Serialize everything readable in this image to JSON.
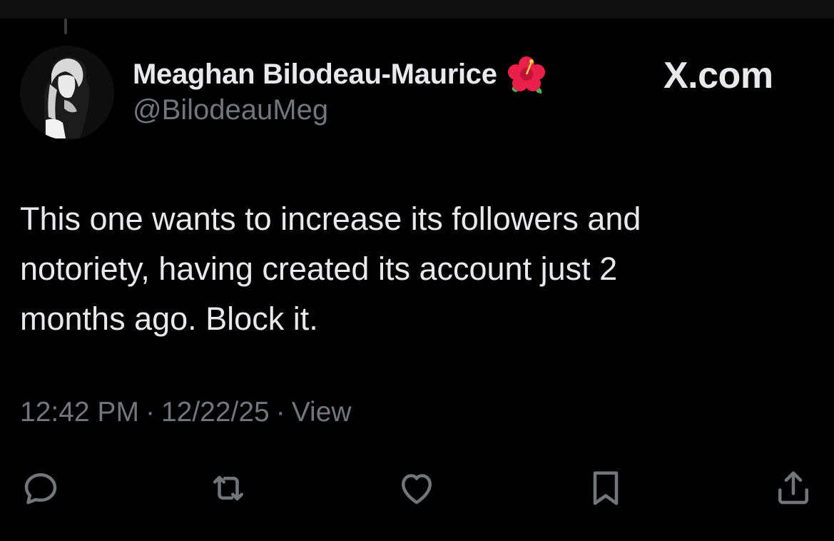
{
  "author": {
    "display_name": "Meaghan Bilodeau-Maurice",
    "handle": "@BilodeauMeg",
    "name_emoji": "hibiscus-icon"
  },
  "brand": {
    "label": "X.com"
  },
  "tweet": {
    "lines": [
      "This one wants to increase its followers and",
      "notoriety, having created its account just 2",
      "months ago. Block it."
    ]
  },
  "meta": {
    "time": "12:42 PM",
    "separator": "·",
    "date": "12/22/25",
    "view_label": "View"
  },
  "actions": [
    {
      "icon": "reply-icon"
    },
    {
      "icon": "repost-icon"
    },
    {
      "icon": "like-icon"
    },
    {
      "icon": "bookmark-icon"
    },
    {
      "icon": "share-icon"
    }
  ],
  "colors": {
    "background": "#000000",
    "primary_text": "#e7e9ea",
    "secondary_text": "#71767b"
  }
}
